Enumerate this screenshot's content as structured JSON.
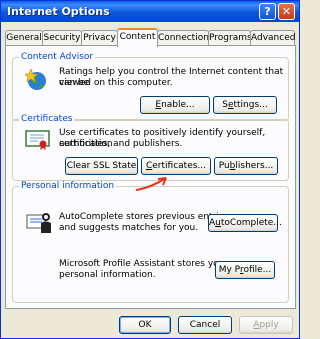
{
  "window": {
    "title": "Internet Options",
    "help_glyph": "?",
    "close_glyph": "✕"
  },
  "tabs": [
    "General",
    "Security",
    "Privacy",
    "Content",
    "Connections",
    "Programs",
    "Advanced"
  ],
  "active_tab": "Content",
  "content_advisor": {
    "legend": "Content Advisor",
    "text_line1": "Ratings help you control the Internet content that can be",
    "text_line2": "viewed on this computer.",
    "enable_pre": "",
    "enable_key": "E",
    "enable_post": "nable...",
    "settings_pre": "S",
    "settings_key": "e",
    "settings_post": "ttings..."
  },
  "certificates": {
    "legend": "Certificates",
    "text_line1": "Use certificates to positively identify yourself, certification",
    "text_line2": "authorities, and publishers.",
    "clear_ssl_label": "Clear SSL State",
    "certs_pre": "",
    "certs_key": "C",
    "certs_post": "ertificates...",
    "publishers_pre": "Pu",
    "publishers_key": "b",
    "publishers_post": "lishers..."
  },
  "personal_information": {
    "legend": "Personal information",
    "autocomplete_line1": "AutoComplete stores previous entries",
    "autocomplete_line2": "and suggests matches for you.",
    "autocomplete_pre": "A",
    "autocomplete_key": "u",
    "autocomplete_post": "toComplete...",
    "profile_line1": "Microsoft Profile Assistant stores your",
    "profile_line2": "personal information.",
    "profile_pre": "My P",
    "profile_key": "r",
    "profile_post": "ofile..."
  },
  "dialog_buttons": {
    "ok": "OK",
    "cancel": "Cancel",
    "apply_key": "A",
    "apply_post": "pply"
  },
  "colors": {
    "title_bar": "#0a56da",
    "legend_text": "#0046d5",
    "annotation_arrow": "#e8301c",
    "tab_highlight": "#e68b2c"
  },
  "icons": [
    "content-advisor-globe-icon",
    "certificate-icon",
    "autocomplete-icon",
    "profile-card-icon",
    "annotation-arrow"
  ]
}
